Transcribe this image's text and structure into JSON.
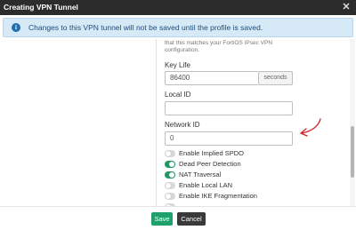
{
  "window": {
    "title": "Creating VPN Tunnel",
    "close_glyph": "✕"
  },
  "banner": {
    "icon": "info-icon",
    "text": "Changes to this VPN tunnel will not be saved until the profile is saved."
  },
  "form": {
    "help_text": "that this matches your FortiOS IPsec VPN configuration.",
    "key_life": {
      "label": "Key Life",
      "value": "86400",
      "unit": "seconds"
    },
    "local_id": {
      "label": "Local ID",
      "value": ""
    },
    "network_id": {
      "label": "Network ID",
      "value": "0"
    },
    "toggles": [
      {
        "label": "Enable Implied SPDO",
        "on": false
      },
      {
        "label": "Dead Peer Detection",
        "on": true
      },
      {
        "label": "NAT Traversal",
        "on": true
      },
      {
        "label": "Enable Local LAN",
        "on": false
      },
      {
        "label": "Enable IKE Fragmentation",
        "on": false
      }
    ]
  },
  "footer": {
    "save_label": "Save",
    "cancel_label": "Cancel"
  },
  "colors": {
    "accent_green": "#1fa16c",
    "annotation_red": "#d0252b",
    "banner_blue": "#d5e9f7"
  }
}
